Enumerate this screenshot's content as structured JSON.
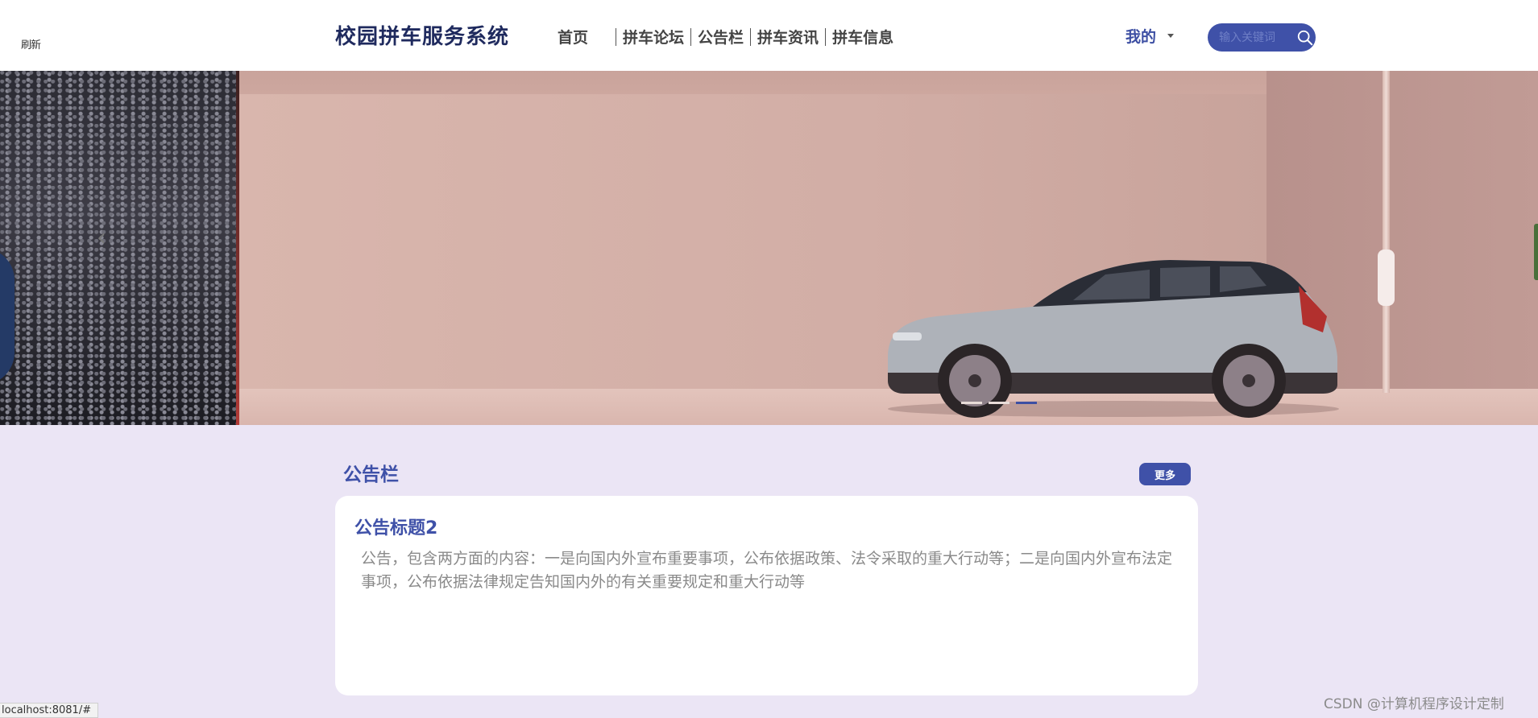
{
  "header": {
    "refresh_label": "刷新",
    "site_title": "校园拼车服务系统",
    "nav": [
      "首页",
      "拼车论坛",
      "公告栏",
      "拼车资讯",
      "拼车信息"
    ],
    "my_label": "我的",
    "search_placeholder": "输入关键词"
  },
  "banner": {
    "slide_count": 3,
    "active_slide": 3
  },
  "notice": {
    "section_title": "公告栏",
    "more_label": "更多",
    "card_title": "公告标题2",
    "card_body": "公告，包含两方面的内容：一是向国内外宣布重要事项，公布依据政策、法令采取的重大行动等；二是向国内外宣布法定事项，公布依据法律规定告知国内外的有关重要规定和重大行动等"
  },
  "status_url": "localhost:8081/#",
  "watermark": "CSDN @计算机程序设计定制",
  "colors": {
    "accent": "#3f51a8",
    "title": "#1f2a5e",
    "page_bg": "#ebe5f5"
  },
  "icons": [
    "search-icon",
    "caret-down-icon",
    "chevron-left-icon",
    "hand-cursor-icon"
  ]
}
